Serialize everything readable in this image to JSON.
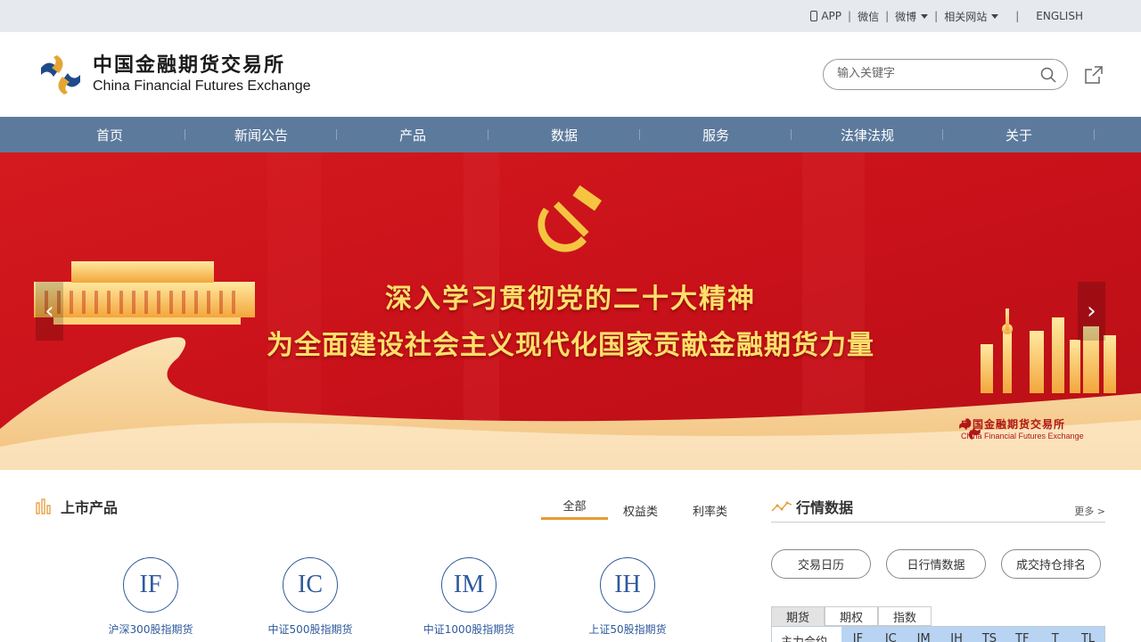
{
  "topbar": {
    "app": "APP",
    "wechat": "微信",
    "weibo": "微博",
    "related": "相关网站",
    "english": "ENGLISH"
  },
  "header": {
    "logo_cn": "中国金融期货交易所",
    "logo_en": "China Financial Futures Exchange",
    "search_placeholder": "输入关键字"
  },
  "nav": [
    "首页",
    "新闻公告",
    "产品",
    "数据",
    "服务",
    "法律法规",
    "关于"
  ],
  "banner": {
    "line1": "深入学习贯彻党的二十大精神",
    "line2": "为全面建设社会主义现代化国家贡献金融期货力量",
    "logo_cn": "中国金融期货交易所",
    "logo_en": "China Financial Futures Exchange",
    "prev": "‹",
    "next": "›"
  },
  "products": {
    "title": "上市产品",
    "tabs": [
      "全部",
      "权益类",
      "利率类"
    ],
    "items": [
      {
        "code": "IF",
        "name": "沪深300股指期货"
      },
      {
        "code": "IC",
        "name": "中证500股指期货"
      },
      {
        "code": "IM",
        "name": "中证1000股指期货"
      },
      {
        "code": "IH",
        "name": "上证50股指期货"
      }
    ]
  },
  "market": {
    "title": "行情数据",
    "more": "更多 >",
    "buttons": [
      "交易日历",
      "日行情数据",
      "成交持仓排名"
    ],
    "tabs": [
      "期货",
      "期权",
      "指数"
    ],
    "row_label": "主力合约",
    "codes": [
      "IF",
      "IC",
      "IM",
      "IH",
      "TS",
      "TF",
      "T",
      "TL"
    ]
  },
  "colors": {
    "nav_bg": "#5c7a9c",
    "topbar_bg": "#e6e9ee",
    "banner_red": "#c8141b",
    "accent_gold": "#ffdf6b",
    "tab_orange": "#e89a37",
    "product_blue": "#2f5a9c"
  }
}
